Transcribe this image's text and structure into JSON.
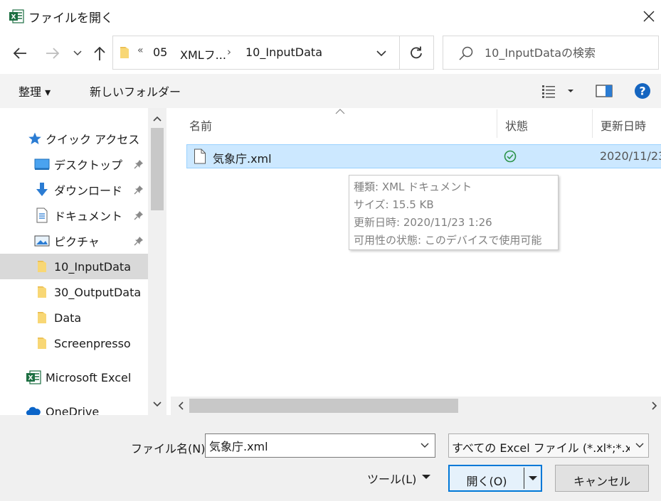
{
  "window": {
    "title": "ファイルを開く"
  },
  "address": {
    "overflow": "«",
    "segments": [
      "05",
      "XMLフ...",
      "10_InputData"
    ],
    "separator": "›"
  },
  "search": {
    "placeholder": "10_InputDataの検索"
  },
  "toolbar": {
    "organize": "整理 ▾",
    "new_folder": "新しいフォルダー"
  },
  "sidebar": {
    "items": [
      {
        "label": "クイック アクセス",
        "icon": "star-icon"
      },
      {
        "label": "デスクトップ",
        "icon": "desktop-icon",
        "pinned": true
      },
      {
        "label": "ダウンロード",
        "icon": "download-icon",
        "pinned": true
      },
      {
        "label": "ドキュメント",
        "icon": "document-icon",
        "pinned": true
      },
      {
        "label": "ピクチャ",
        "icon": "picture-icon",
        "pinned": true
      },
      {
        "label": "10_InputData",
        "icon": "folder-icon",
        "selected": true
      },
      {
        "label": "30_OutputData",
        "icon": "folder-icon"
      },
      {
        "label": "Data",
        "icon": "folder-icon"
      },
      {
        "label": "Screenpresso",
        "icon": "folder-icon"
      },
      {
        "label": "Microsoft Excel",
        "icon": "excel-icon"
      },
      {
        "label": "OneDrive",
        "icon": "cloud-icon"
      }
    ]
  },
  "columns": {
    "name": "名前",
    "status": "状態",
    "date": "更新日時"
  },
  "files": [
    {
      "name": "気象庁.xml",
      "status": "synced",
      "date": "2020/11/23"
    }
  ],
  "tooltip": {
    "lines": [
      "種類: XML ドキュメント",
      "サイズ: 15.5 KB",
      "更新日時: 2020/11/23 1:26",
      "可用性の状態: このデバイスで使用可能"
    ]
  },
  "bottom": {
    "filename_label": "ファイル名(N):",
    "filename_value": "気象庁.xml",
    "filetype": "すべての Excel ファイル (*.xl*;*.xlsx;*",
    "tools": "ツール(L)",
    "open": "開く(O)",
    "cancel": "キャンセル"
  },
  "colors": {
    "selection": "#cce8ff",
    "selection_border": "#99d1ff",
    "accent": "#0078d7",
    "excel_green": "#1d6f42",
    "folder": "#f8d775",
    "status_green": "#2b9348"
  }
}
